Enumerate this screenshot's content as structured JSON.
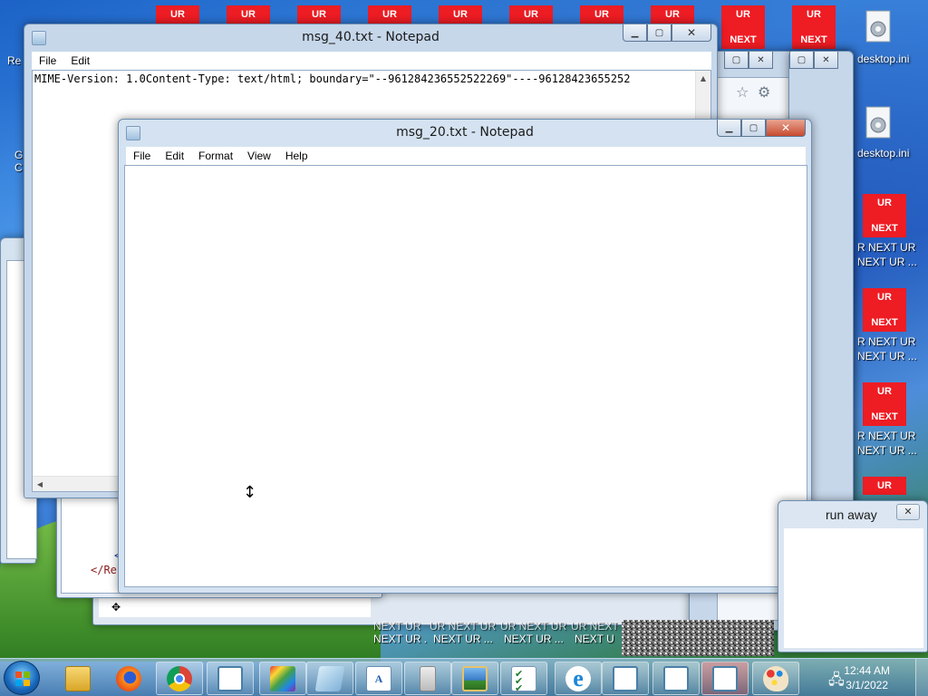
{
  "desktop": {
    "tiles_top": [
      {
        "top": "UR",
        "bottom": ""
      },
      {
        "top": "UR",
        "bottom": ""
      },
      {
        "top": "UR",
        "bottom": ""
      },
      {
        "top": "UR",
        "bottom": ""
      },
      {
        "top": "UR",
        "bottom": ""
      },
      {
        "top": "UR",
        "bottom": ""
      },
      {
        "top": "UR",
        "bottom": ""
      },
      {
        "top": "UR",
        "bottom": ""
      },
      {
        "top": "UR",
        "bottom": "NEXT"
      },
      {
        "top": "UR",
        "bottom": "NEXT"
      }
    ],
    "tiles_right": [
      {
        "top": "UR",
        "bottom": "NEXT"
      },
      {
        "top": "UR",
        "bottom": "NEXT"
      },
      {
        "top": "UR",
        "bottom": "NEXT"
      },
      {
        "top": "UR",
        "bottom": ""
      }
    ],
    "right_labels": [
      "R NEXT UR",
      "NEXT UR ..."
    ],
    "desktop_ini_label": "desktop.ini",
    "left_fragments": [
      "Re",
      "G",
      "C"
    ],
    "bottom_strip": [
      "NEXT UR ...",
      "NEXT UR ...",
      "NEXT UR ...",
      "NEXT U"
    ],
    "bottom_strip_top": [
      "NEXT UR",
      "UR NEXT UR",
      "UR NEXT UR",
      "UR NEXT UR"
    ],
    "code_fragments": [
      "<",
      "</Re"
    ]
  },
  "window_back": {
    "title": "msg_40.txt - Notepad",
    "menu": [
      "File",
      "Edit"
    ],
    "content_line": "MIME-Version: 1.0Content-Type: text/html; boundary=\"--961284236552522269\"----96128423655252"
  },
  "window_front": {
    "title": "msg_20.txt - Notepad",
    "menu": [
      "File",
      "Edit",
      "Format",
      "View",
      "Help"
    ],
    "content": ""
  },
  "popup": {
    "title": "run away"
  },
  "taskbar": {
    "apps": [
      "start",
      "explorer",
      "firefox",
      "chrome",
      "notepad",
      "paint",
      "notepad2",
      "wordpad",
      "file-manager",
      "image-viewer",
      "task-list",
      "internet-explorer",
      "notepad3",
      "notepad4",
      "notepad5",
      "paint2"
    ],
    "time": "12:44 AM",
    "date": "3/1/2022"
  }
}
